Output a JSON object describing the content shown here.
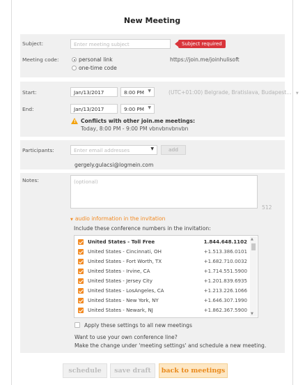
{
  "header": {
    "title": "New Meeting"
  },
  "form": {
    "subject_label": "Subject:",
    "subject_placeholder": "Enter meeting subject",
    "subject_error": "Subject required",
    "meeting_code_label": "Meeting code:",
    "code_option_personal": "personal link",
    "code_option_onetime": "one-time code",
    "personal_link": "https://join.me/joinhulisoft",
    "start_label": "Start:",
    "start_date": "Jan/13/2017",
    "start_time": "8:00 PM",
    "timezone": "(UTC+01:00) Belgrade, Bratislava, Budapest...",
    "end_label": "End:",
    "end_date": "Jan/13/2017",
    "end_time": "9:00 PM",
    "conflict_title": "Conflicts with other join.me meetings:",
    "conflict_detail": "Today, 8:00 PM - 9:00 PM  vbnvbnvbnvbn",
    "participants_label": "Participants:",
    "participants_placeholder": "Enter email addresses",
    "add_button": "add",
    "participant_email": "gergely.gulacsi@logmein.com",
    "notes_label": "Notes:",
    "notes_placeholder": "(optional)",
    "notes_remaining": "512"
  },
  "audio": {
    "toggle_label": "audio information in the invitation",
    "include_text": "Include these conference numbers in the invitation:",
    "numbers": [
      {
        "country": "United States - Toll Free",
        "number": "1.844.648.1102",
        "bold": true
      },
      {
        "country": "United States - Cincinnati, OH",
        "number": "+1.513.386.0101"
      },
      {
        "country": "United States - Fort Worth, TX",
        "number": "+1.682.710.0032"
      },
      {
        "country": "United States - Irvine, CA",
        "number": "+1.714.551.5900"
      },
      {
        "country": "United States - Jersey City",
        "number": "+1.201.839.6935"
      },
      {
        "country": "United States - LosAngeles, CA",
        "number": "+1.213.226.1066"
      },
      {
        "country": "United States - New York, NY",
        "number": "+1.646.307.1990"
      },
      {
        "country": "United States - Newark, NJ",
        "number": "+1.862.367.5900"
      }
    ],
    "apply_all_label": "Apply these settings to all new meetings",
    "own_line_q": "Want to use your own conference line?",
    "own_line_hint": "Make the change under 'meeting settings' and schedule a new meeting."
  },
  "footer": {
    "schedule": "schedule",
    "save_draft": "save draft",
    "back": "back to meetings"
  },
  "colors": {
    "accent": "#f28a22",
    "error": "#d9353b",
    "warning": "#f3a20d"
  }
}
